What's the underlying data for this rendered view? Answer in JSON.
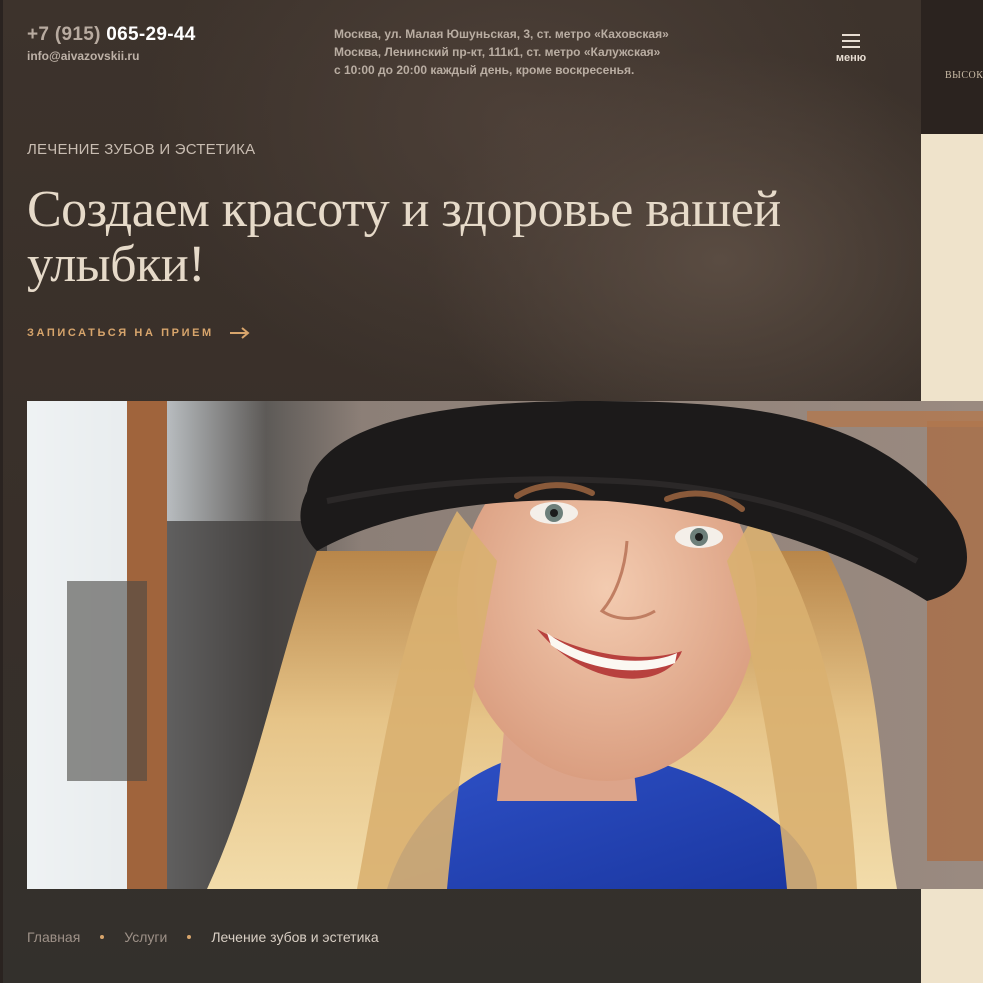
{
  "header": {
    "phone_code": "+7 (915)",
    "phone_number": "065-29-44",
    "email": "info@aivazovskii.ru",
    "addresses": [
      "Москва, ул. Малая Юшуньская, 3, ст. метро «Каховская»",
      "Москва, Ленинский пр-кт, 111к1, ст. метро «Калужская»",
      "с 10:00 до 20:00 каждый день, кроме воскресенья."
    ],
    "menu_label": "меню"
  },
  "hero": {
    "category": "ЛЕЧЕНИЕ ЗУБОВ И ЭСТЕТИКА",
    "title": "Создаем красоту и здоровье вашей улыбки!",
    "cta_label": "ЗАПИСАТЬСЯ НА ПРИЕМ"
  },
  "breadcrumb": {
    "items": [
      "Главная",
      "Услуги",
      "Лечение зубов и эстетика"
    ]
  },
  "side_panel": {
    "peek_text": "ВЫСОК"
  },
  "colors": {
    "accent": "#d8a56c",
    "background": "#3a302a",
    "title": "#e6dac9",
    "side_panel": "#efe3cb"
  },
  "icons": {
    "menu": "hamburger-icon",
    "cta": "arrow-right-icon"
  }
}
